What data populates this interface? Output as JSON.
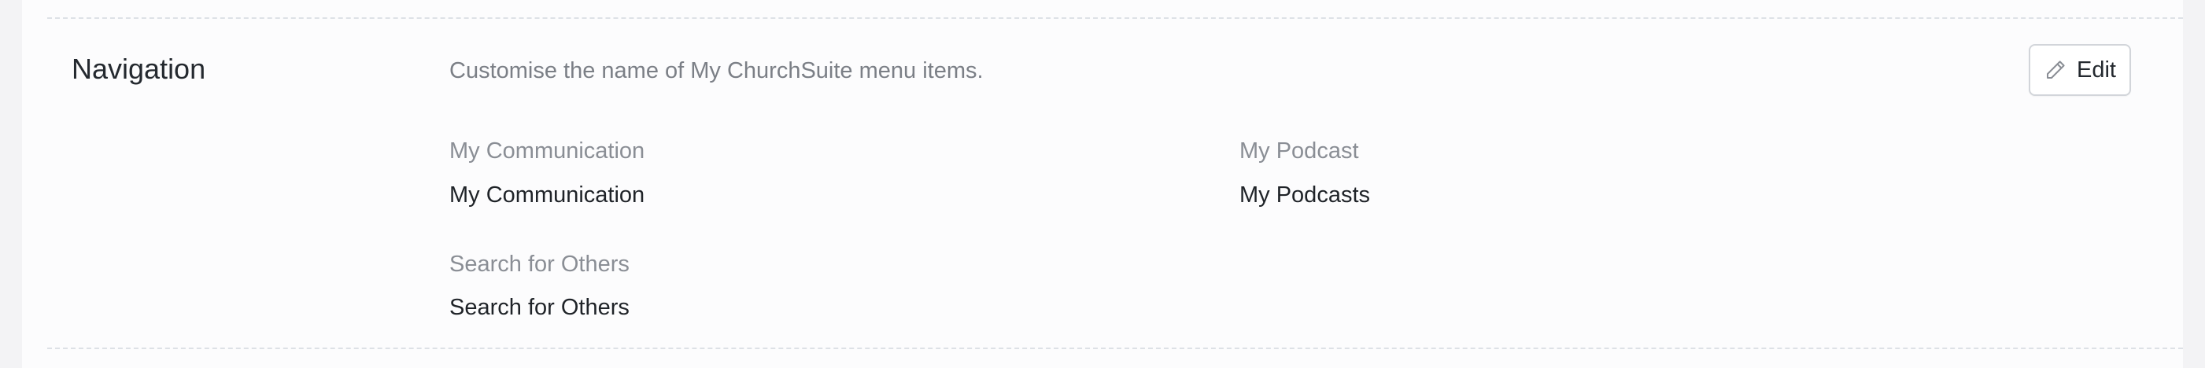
{
  "section": {
    "title": "Navigation",
    "description": "Customise the name of My ChurchSuite menu items.",
    "edit_label": "Edit",
    "edit_icon": "pencil-icon"
  },
  "fields": [
    {
      "label": "My Communication",
      "value": "My Communication"
    },
    {
      "label": "My Podcast",
      "value": "My Podcasts"
    },
    {
      "label": "Search for Others",
      "value": "Search for Others"
    }
  ],
  "colors": {
    "background": "#f3f3f5",
    "panel": "#fcfcfd",
    "label_text": "#8a8e95",
    "value_text": "#1f2328",
    "divider": "#dde1e6"
  }
}
